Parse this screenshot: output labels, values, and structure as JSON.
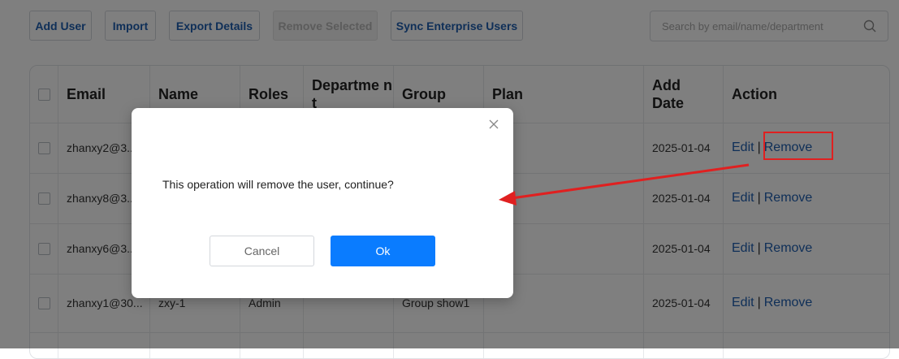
{
  "toolbar": {
    "add_user": "Add User",
    "import": "Import",
    "export": "Export Details",
    "remove_selected": "Remove Selected",
    "sync": "Sync Enterprise Users",
    "search_placeholder": "Search by email/name/department"
  },
  "table": {
    "headers": {
      "email": "Email",
      "name": "Name",
      "roles": "Roles",
      "department": "Departme nt",
      "group": "Group",
      "plan": "Plan",
      "add_date": "Add Date",
      "action": "Action"
    },
    "rows": [
      {
        "email": "zhanxy2@3...",
        "name": "",
        "roles": "",
        "department": "",
        "group": "",
        "plan": "",
        "add_date": "2025-01-04",
        "edit": "Edit",
        "sep": "|",
        "remove": "Remove"
      },
      {
        "email": "zhanxy8@3...",
        "name": "",
        "roles": "",
        "department": "",
        "group": "",
        "plan": "",
        "add_date": "2025-01-04",
        "edit": "Edit",
        "sep": "|",
        "remove": "Remove"
      },
      {
        "email": "zhanxy6@3...",
        "name": "",
        "roles": "",
        "department": "",
        "group": "",
        "plan": "",
        "add_date": "2025-01-04",
        "edit": "Edit",
        "sep": "|",
        "remove": "Remove"
      },
      {
        "email": "zhanxy1@30...",
        "name": "zxy-1",
        "roles": "Admin",
        "department": "",
        "group": "Group show1",
        "plan": "",
        "add_date": "2025-01-04",
        "edit": "Edit",
        "sep": "|",
        "remove": "Remove"
      }
    ]
  },
  "dialog": {
    "message": "This operation will remove the user, continue?",
    "cancel": "Cancel",
    "ok": "Ok"
  },
  "colors": {
    "accent": "#0a7cff",
    "link": "#1f5fb0",
    "annotation": "#e02020",
    "overlay": "rgba(0,0,0,0.5)"
  },
  "icons": {
    "search": "search-icon",
    "close": "close-icon",
    "checkbox": "checkbox-icon",
    "arrow": "annotation-arrow"
  }
}
